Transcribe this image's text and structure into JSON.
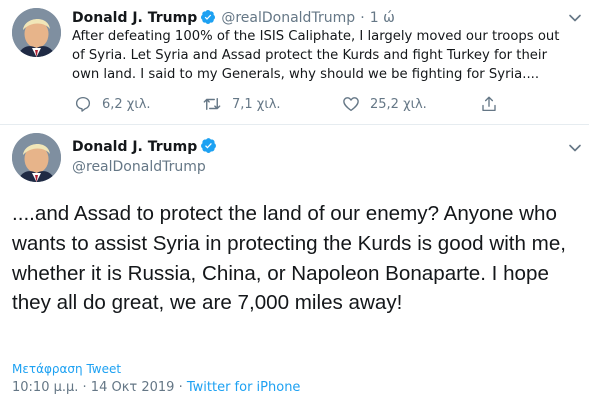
{
  "colors": {
    "accent": "#1da1f2",
    "muted": "#657786",
    "text": "#14171a",
    "divider": "#e6ecf0"
  },
  "quoted_tweet": {
    "author_name": "Donald J. Trump",
    "handle": "@realDonaldTrump",
    "separator": "·",
    "time": "1 ώ",
    "text": "After defeating 100% of the ISIS Caliphate, I largely moved our troops out of Syria. Let Syria and Assad protect the Kurds and fight Turkey for their own land. I said to my Generals, why should we be fighting for Syria....",
    "actions": {
      "replies": "6,2 χιλ.",
      "retweets": "7,1 χιλ.",
      "likes": "25,2 χιλ."
    },
    "icons": [
      "verified-badge-icon",
      "chevron-down-icon",
      "reply-icon",
      "retweet-icon",
      "heart-icon",
      "share-icon"
    ]
  },
  "main_tweet": {
    "author_name": "Donald J. Trump",
    "handle": "@realDonaldTrump",
    "text": "....and Assad to protect the land of our enemy? Anyone who wants to assist Syria in protecting the Kurds is good with me, whether it is Russia, China, or Napoleon Bonaparte. I hope they all do great, we are 7,000 miles away!",
    "translate_label": "Μετάφραση Tweet",
    "timestamp": "10:10 μ.μ. · 14 Οκτ 2019",
    "meta_separator": "·",
    "source": "Twitter for iPhone"
  }
}
